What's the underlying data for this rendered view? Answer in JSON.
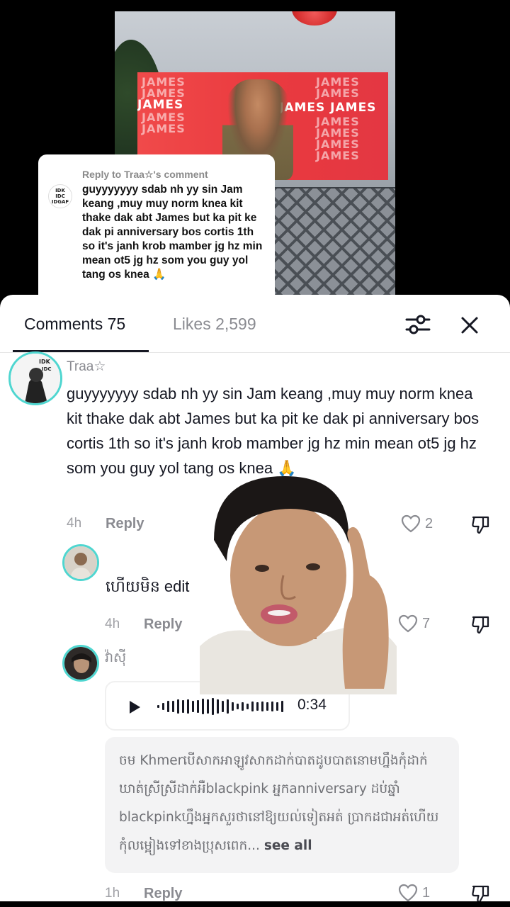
{
  "video": {
    "billboard_word": "JAMES",
    "billboard_strong": "JAMES JAMES",
    "reply_bubble": {
      "header": "Reply to Traa☆'s comment",
      "text": "guyyyyyyy sdab nh yy sin Jam keang ,muy muy norm knea kit thake dak abt James but ka pit ke dak pi anniversary bos cortis 1th so it's janh krob mamber jg hz min mean ot5 jg hz som you guy yol tang os knea 🙏"
    }
  },
  "sheet": {
    "tabs": [
      {
        "label": "Comments 75"
      },
      {
        "label": "Likes 2,599"
      }
    ],
    "icons": {
      "filter": "sliders-icon",
      "close": "close-icon"
    },
    "comments": [
      {
        "username": "Traa☆",
        "text": "guyyyyyyy sdab nh yy sin Jam keang ,muy muy norm knea kit thake dak abt James but ka pit ke dak pi anniversary bos cortis 1th so it's janh krob mamber jg hz min mean ot5 jg hz som you guy yol tang os knea 🙏",
        "time": "4h",
        "reply_label": "Reply",
        "likes": "2"
      },
      {
        "username": "",
        "text": "ហើយមិន edit",
        "time": "4h",
        "reply_label": "Reply",
        "likes": "7"
      },
      {
        "username": "វ៉ាសុី",
        "audio_duration": "0:34",
        "transcript": "ចម Khmerបើសាកអាឡូវសាកដាក់បាតដូបបាតនោមហ្នឹងកុំដាក់ឃាត់ស្រីស្រីដាក់អឺblackpink អ្នកanniversary ដប់ឆ្នាំ blackpinkហ្នឹងអ្នកសួរថានៅឱ្យយល់ទៀតអត់ ប្រាកដជាអត់ហើយកុំលម្អៀងទៅខាងប្រុសពេក...",
        "see_all": "see all",
        "time": "1h",
        "reply_label": "Reply",
        "likes": "1"
      }
    ]
  }
}
